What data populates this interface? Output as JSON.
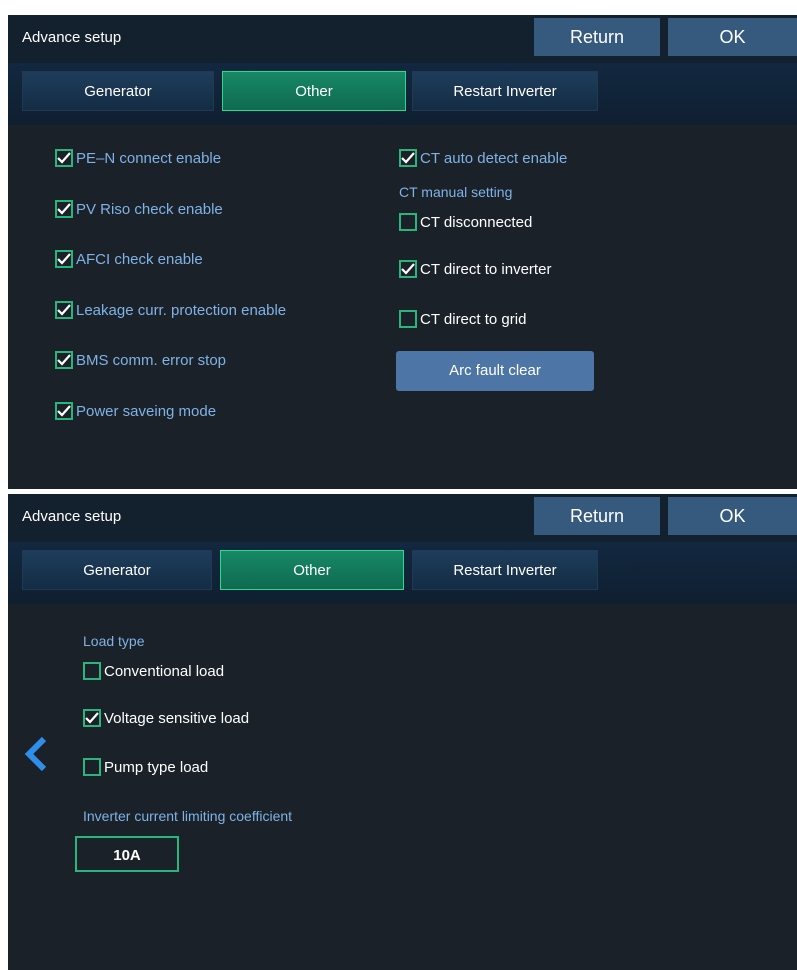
{
  "panels": [
    {
      "title": "Advance setup",
      "return_label": "Return",
      "ok_label": "OK",
      "tabs": [
        "Generator",
        "Other",
        "Restart Inverter"
      ],
      "active_tab": "Other"
    },
    {
      "title": "Advance setup",
      "return_label": "Return",
      "ok_label": "OK",
      "tabs": [
        "Generator",
        "Other",
        "Restart Inverter"
      ],
      "active_tab": "Other"
    }
  ],
  "other_page": {
    "left_options": [
      {
        "label": "PE–N connect enable",
        "checked": true
      },
      {
        "label": "PV Riso check enable",
        "checked": true
      },
      {
        "label": "AFCI check enable",
        "checked": true
      },
      {
        "label": "Leakage curr. protection enable",
        "checked": true
      },
      {
        "label": "BMS comm. error stop",
        "checked": true
      },
      {
        "label": "Power saveing mode",
        "checked": true
      }
    ],
    "ct_auto": {
      "label": "CT auto detect enable",
      "checked": true
    },
    "ct_manual_label": "CT manual setting",
    "ct_manual_options": [
      {
        "label": "CT disconnected",
        "checked": false
      },
      {
        "label": "CT direct to inverter",
        "checked": true
      },
      {
        "label": "CT direct to grid",
        "checked": false
      }
    ],
    "arc_fault_clear_label": "Arc fault clear"
  },
  "load_page": {
    "load_type_label": "Load type",
    "load_options": [
      {
        "label": "Conventional load",
        "checked": false
      },
      {
        "label": "Voltage sensitive load",
        "checked": true
      },
      {
        "label": "Pump type load",
        "checked": false
      }
    ],
    "coefficient_label": "Inverter current limiting coefficient",
    "coefficient_value": "10A",
    "back_icon": "chevron-left-icon"
  },
  "colors": {
    "panel_bg": "#1a2128",
    "header_bg": "#13202e",
    "button_blue": "#36597e",
    "active_tab_green": "#178866",
    "checkbox_green": "#29b57c",
    "label_blue": "#7fb2e6",
    "arrow_blue": "#2f8fe8"
  }
}
